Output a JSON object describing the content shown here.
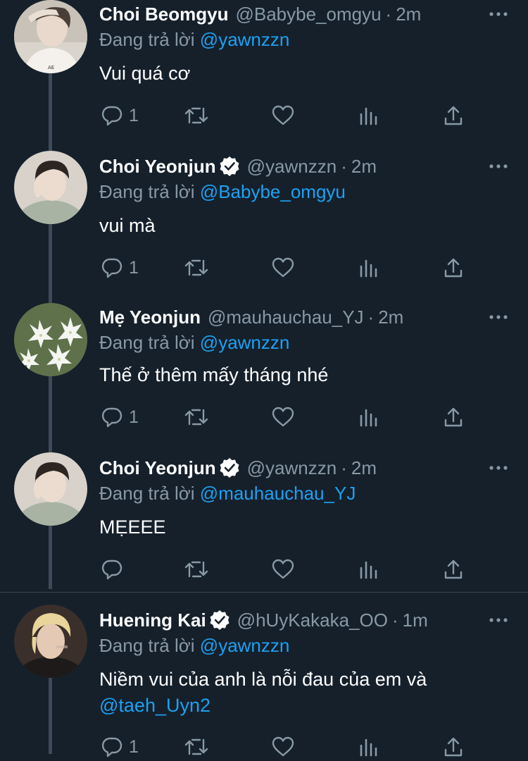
{
  "tweets": [
    {
      "name": "Choi Beomgyu",
      "verified": false,
      "handle": "@Babybe_omgyu",
      "time": "2m",
      "reply_prefix": "Đang trả lời",
      "reply_to": "@yawnzzn",
      "text": "Vui quá cơ",
      "mention": "",
      "reply_count": "1",
      "avatar": "avatar-beomgyu"
    },
    {
      "name": "Choi Yeonjun",
      "verified": true,
      "handle": "@yawnzzn",
      "time": "2m",
      "reply_prefix": "Đang trả lời",
      "reply_to": "@Babybe_omgyu",
      "text": "vui mà",
      "mention": "",
      "reply_count": "1",
      "avatar": "avatar-yeonjun"
    },
    {
      "name": "Mẹ Yeonjun",
      "verified": false,
      "handle": "@mauhauchau_YJ",
      "time": "2m",
      "reply_prefix": "Đang trả lời",
      "reply_to": "@yawnzzn",
      "text": "Thế ở thêm mấy tháng nhé",
      "mention": "",
      "reply_count": "1",
      "avatar": "avatar-lilies"
    },
    {
      "name": "Choi Yeonjun",
      "verified": true,
      "handle": "@yawnzzn",
      "time": "2m",
      "reply_prefix": "Đang trả lời",
      "reply_to": "@mauhauchau_YJ",
      "text": "MẸEEE",
      "mention": "",
      "reply_count": "",
      "avatar": "avatar-yeonjun"
    },
    {
      "name": "Huening Kai",
      "verified": true,
      "handle": "@hUyKakaka_OO",
      "time": "1m",
      "reply_prefix": "Đang trả lời",
      "reply_to": "@yawnzzn",
      "text": "Niềm vui của anh là nỗi đau của em và",
      "mention": "@taeh_Uyn2",
      "reply_count": "1",
      "avatar": "avatar-kai"
    }
  ],
  "icons": {
    "more": "more-horizontal-icon",
    "reply": "reply-icon",
    "retweet": "retweet-icon",
    "like": "heart-icon",
    "analytics": "analytics-icon",
    "share": "share-icon",
    "verified": "verified-badge-icon"
  },
  "colors": {
    "background": "#15202b",
    "text": "#ffffff",
    "secondary": "#8899a6",
    "link": "#1da1f2",
    "thread_line": "#3d4a57",
    "divider": "#38444d"
  }
}
